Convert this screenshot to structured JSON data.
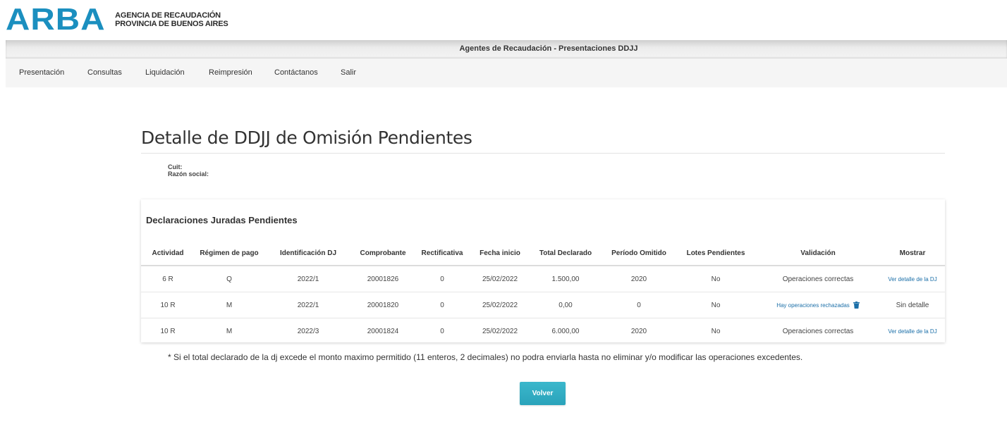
{
  "header": {
    "logo": "ARBA",
    "agency_line1": "AGENCIA DE RECAUDACIÓN",
    "agency_line2": "PROVINCIA DE BUENOS AIRES",
    "title": "Agentes de Recaudación - Presentaciones DDJJ"
  },
  "menu": [
    {
      "label": "Presentación"
    },
    {
      "label": "Consultas"
    },
    {
      "label": "Liquidación"
    },
    {
      "label": "Reimpresión"
    },
    {
      "label": "Contáctanos"
    },
    {
      "label": "Salir"
    }
  ],
  "page": {
    "title": "Detalle de DDJJ de Omisión Pendientes",
    "cuit_label": "Cuit:",
    "razon_label": "Razón social:"
  },
  "panel": {
    "heading": "Declaraciones Juradas Pendientes",
    "columns": [
      "Actividad",
      "Régimen de pago",
      "Identificación DJ",
      "Comprobante",
      "Rectificativa",
      "Fecha inicio",
      "Total Declarado",
      "Período Omitido",
      "Lotes Pendientes",
      "Validación",
      "Mostrar"
    ],
    "rows": [
      {
        "actividad": "6 R",
        "regimen": "Q",
        "identificacion": "2022/1",
        "comprobante": "20001826",
        "rectificativa": "0",
        "fecha": "25/02/2022",
        "total": "1.500,00",
        "periodo": "2020",
        "lotes": "No",
        "validacion": "Operaciones correctas",
        "mostrar": "Ver detalle de la DJ"
      },
      {
        "actividad": "10 R",
        "regimen": "M",
        "identificacion": "2022/1",
        "comprobante": "20001820",
        "rectificativa": "0",
        "fecha": "25/02/2022",
        "total": "0,00",
        "periodo": "0",
        "lotes": "No",
        "validacion": "Hay operaciones rechazadas",
        "mostrar": "Sin detalle"
      },
      {
        "actividad": "10 R",
        "regimen": "M",
        "identificacion": "2022/3",
        "comprobante": "20001824",
        "rectificativa": "0",
        "fecha": "25/02/2022",
        "total": "6.000,00",
        "periodo": "2020",
        "lotes": "No",
        "validacion": "Operaciones correctas",
        "mostrar": "Ver detalle de la DJ"
      }
    ]
  },
  "footnote": "*  Si el total declarado de la dj excede el monto maximo permitido (11 enteros, 2 decimales) no podra enviarla hasta no eliminar y/o modificar las operaciones excedentes.",
  "buttons": {
    "volver": "Volver"
  },
  "colors": {
    "brand": "#1b8fbf",
    "button": "#2aa3ba",
    "link": "#1b6fa8"
  }
}
